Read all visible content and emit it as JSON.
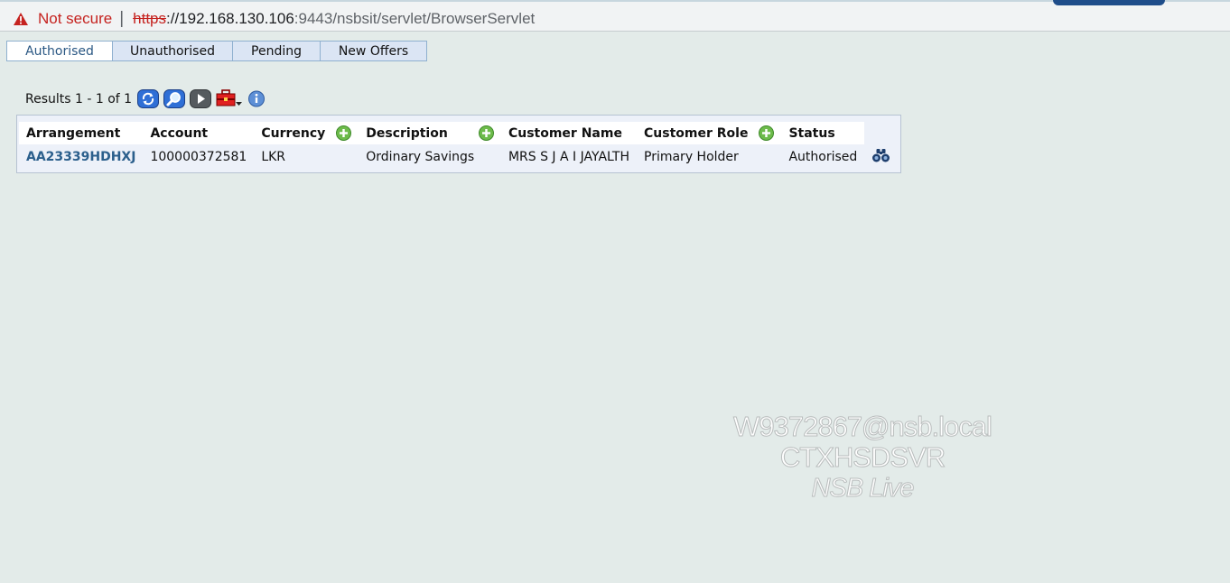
{
  "address_bar": {
    "warning_icon": "warning-triangle-icon",
    "not_secure": "Not secure",
    "separator": "|",
    "scheme": "https",
    "host": "://192.168.130.106",
    "path": ":9443/nsbsit/servlet/BrowserServlet"
  },
  "tabs": [
    {
      "label": "Authorised",
      "active": true
    },
    {
      "label": "Unauthorised",
      "active": false
    },
    {
      "label": "Pending",
      "active": false
    },
    {
      "label": "New Offers",
      "active": false
    }
  ],
  "results": {
    "text": "Results 1 - 1 of 1",
    "icons": [
      "refresh-icon",
      "search-icon",
      "next-page-icon",
      "toolbox-icon",
      "info-icon"
    ]
  },
  "table": {
    "columns": [
      "Arrangement",
      "Account",
      "Currency",
      "Description",
      "Customer Name",
      "Customer Role",
      "Status"
    ],
    "rows": [
      {
        "arrangement": "AA23339HDHXJ",
        "account": "100000372581",
        "currency": "LKR",
        "description": "Ordinary Savings",
        "customer_name": "MRS S J A I JAYALTH",
        "customer_role": "Primary Holder",
        "status": "Authorised"
      }
    ],
    "row_action_icon": "binoculars-icon"
  },
  "watermark": {
    "line1": "W9372867@nsb.local",
    "line2": "CTXHSDSVR",
    "line3": "NSB Live"
  },
  "colors": {
    "background": "#e3ebe9",
    "link": "#2b5f8c",
    "warning": "#c5221f",
    "tab_border": "#8fb0cf"
  }
}
